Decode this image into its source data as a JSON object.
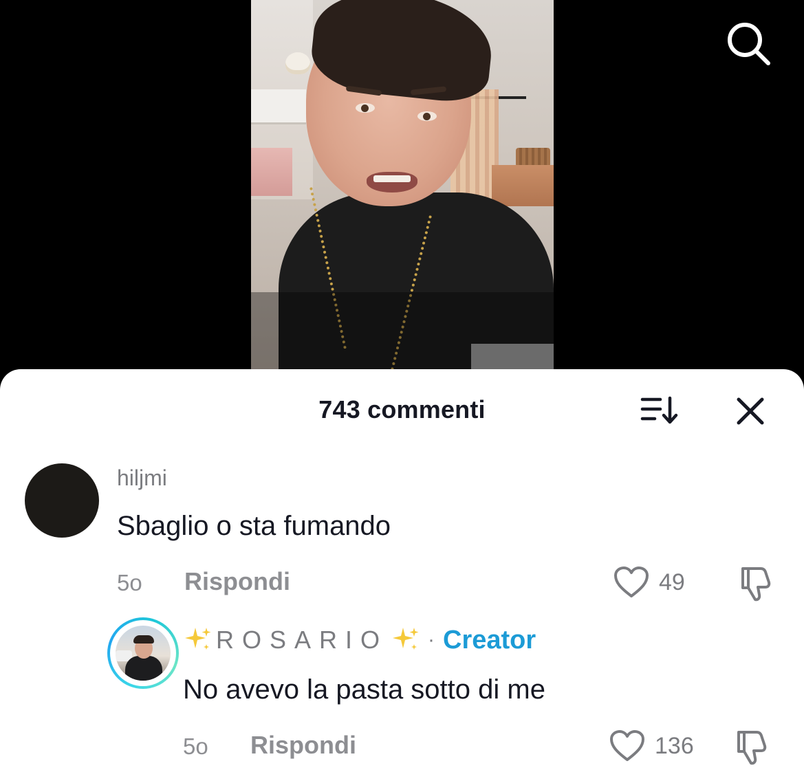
{
  "video": {
    "description_icons": [
      "person-crying",
      "living-room-background"
    ]
  },
  "top_bar": {
    "search_icon": "search-icon"
  },
  "comments_panel": {
    "title": "743 commenti",
    "sort_icon": "sort-icon",
    "close_icon": "close-icon",
    "comments": [
      {
        "username": "hiljmi",
        "text": "Sbaglio o sta fumando",
        "time": "5o",
        "reply_label": "Rispondi",
        "likes": "49"
      }
    ],
    "reply": {
      "username_prefix_emoji": "✨",
      "username": "ROSARIO",
      "username_suffix_emoji": "✨",
      "separator": "·",
      "badge": "Creator",
      "text": "No avevo la pasta sotto di me",
      "time": "5o",
      "reply_label": "Rispondi",
      "likes": "136"
    }
  },
  "colors": {
    "sheet_background": "#ffffff",
    "creator_badge": "#1c9bd6",
    "avatar_ring": "#22a7f0",
    "muted_text": "#8d8e92"
  }
}
